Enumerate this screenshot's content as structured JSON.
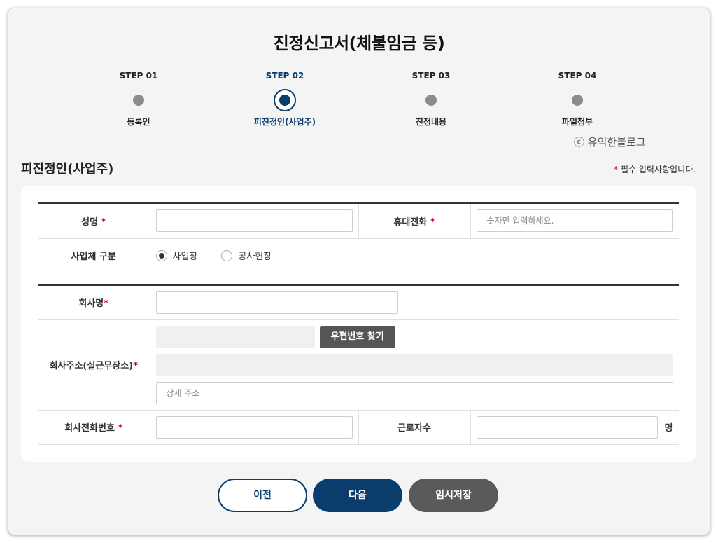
{
  "page": {
    "title": "진정신고서(체불임금 등)",
    "watermark": "ⓒ 유익한블로그"
  },
  "steps": [
    {
      "label": "STEP 01",
      "name": "등록인"
    },
    {
      "label": "STEP 02",
      "name": "피진정인(사업주)"
    },
    {
      "label": "STEP 03",
      "name": "진정내용"
    },
    {
      "label": "STEP 04",
      "name": "파일첨부"
    }
  ],
  "section": {
    "title": "피진정인(사업주)",
    "required_star": "*",
    "required_note": "필수 입력사항입니다."
  },
  "form": {
    "name_label": "성명",
    "name_value": "",
    "phone_label": "휴대전화",
    "phone_placeholder": "숫자만 입력하세요.",
    "biz_type_label": "사업체 구분",
    "biz_type_options": [
      "사업장",
      "공사현장"
    ],
    "biz_type_selected": "사업장",
    "company_label": "회사명",
    "address_label": "회사주소(실근무장소)",
    "zip_button": "우편번호 찾기",
    "address_detail_placeholder": "상세 주소",
    "company_phone_label": "회사전화번호",
    "workers_label": "근로자수",
    "workers_unit": "명"
  },
  "buttons": {
    "prev": "이전",
    "next": "다음",
    "temp_save": "임시저장"
  },
  "colors": {
    "primary": "#0a3d6b",
    "required": "#d6001c",
    "inactive_step": "#8c8c8c",
    "temp_save": "#5a5a5a"
  }
}
